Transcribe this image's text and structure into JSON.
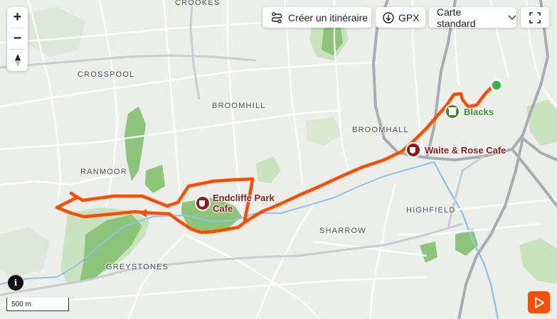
{
  "toolbar": {
    "create_route_label": "Créer un itinéraire",
    "gpx_label": "GPX",
    "map_style_label": "Carte standard"
  },
  "zoom": {
    "in_label": "+",
    "out_label": "−"
  },
  "scale": {
    "label": "500 m"
  },
  "place_labels": {
    "crookes": "CROOKES",
    "crosspool": "CROSSPOOL",
    "broomhill": "BROOMHILL",
    "broomhall": "BROOMHALL",
    "ranmoor": "RANMOOR",
    "highfield": "HIGHFIELD",
    "sharrow": "SHARROW",
    "greystones": "GREYSTONES"
  },
  "pois": {
    "endcliffe": "Endcliffe Park\nCafe",
    "waite_rose": "Waite & Rose Cafe",
    "blacks": "Blacks"
  },
  "colors": {
    "route": "#fc4c02",
    "cafe_poi": "#8b1a1a",
    "shop_poi": "#3c8c2c",
    "start_marker": "#3cb34a",
    "park": "#c9e3bf",
    "woodland": "#8cc47a",
    "water": "#8fc3e8",
    "major_road": "#a9adb2"
  },
  "icons": {
    "zoom_in": "plus-icon",
    "zoom_out": "minus-icon",
    "compass": "compass-icon",
    "route": "route-icon",
    "download": "download-icon",
    "chevron": "chevron-down-icon",
    "fullscreen": "fullscreen-icon",
    "info": "info-icon",
    "play": "play-icon",
    "cafe": "coffee-cup-icon",
    "shop": "shop-icon"
  }
}
